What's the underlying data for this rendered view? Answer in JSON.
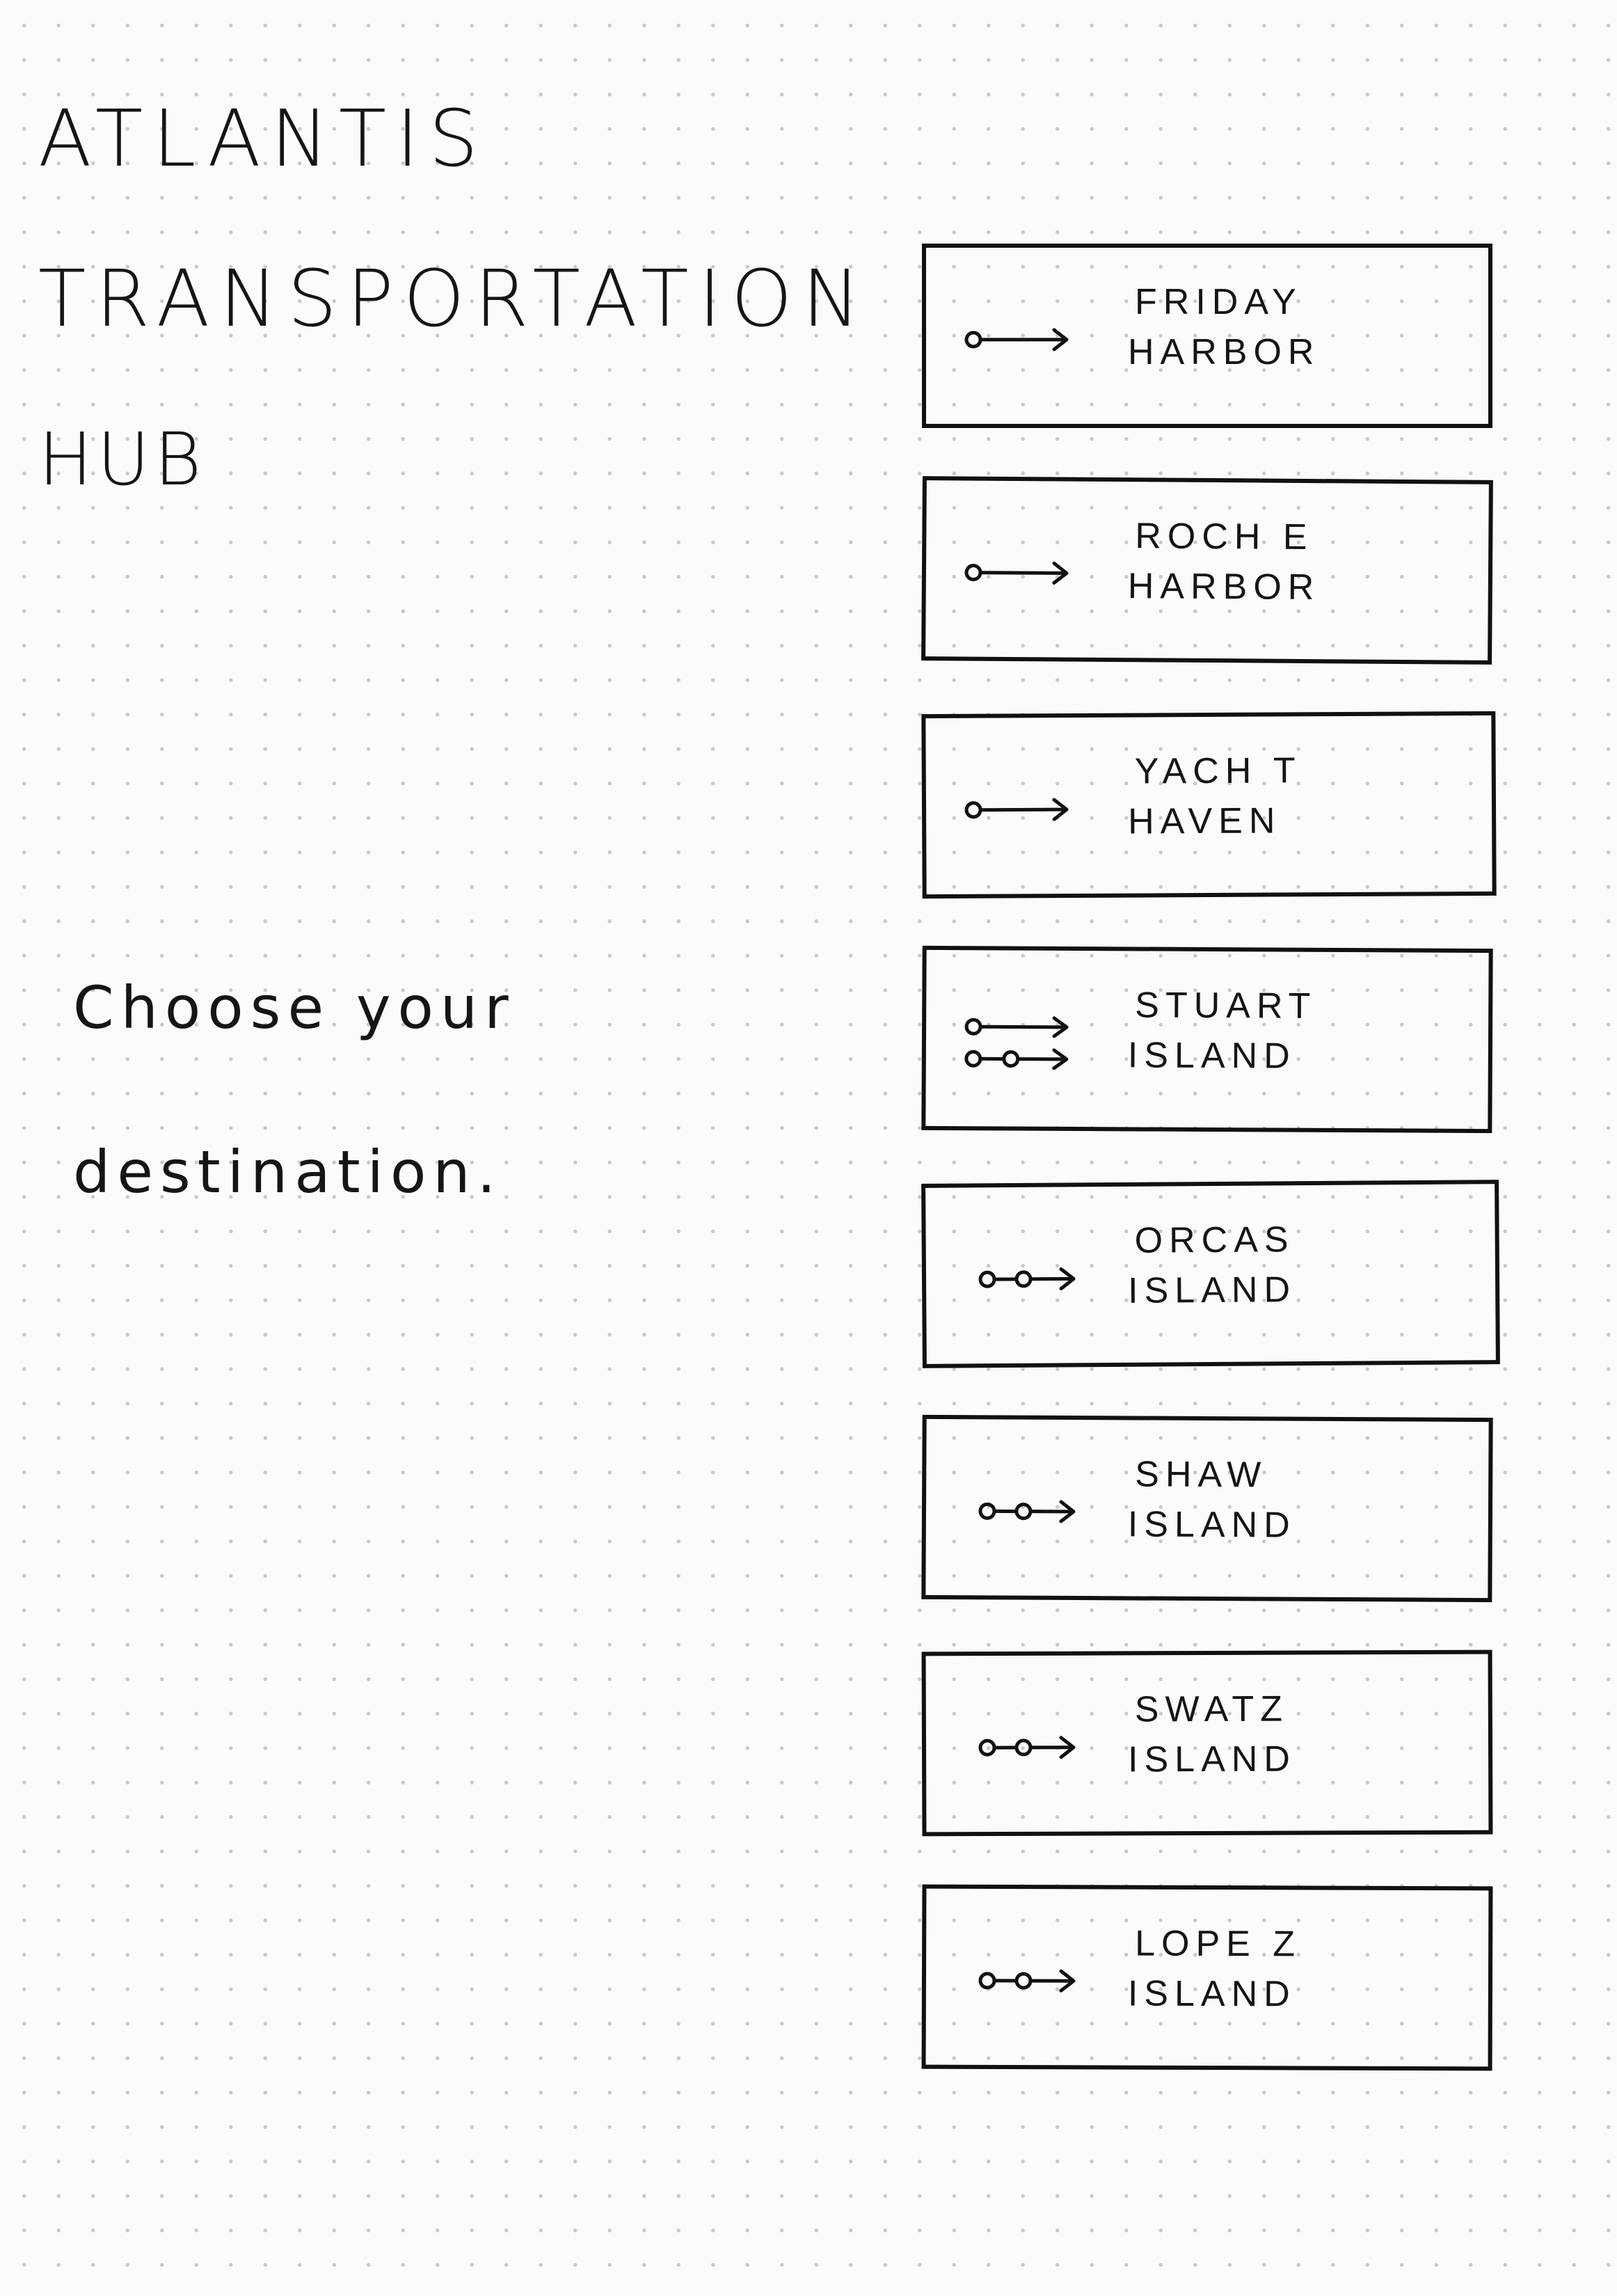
{
  "title": {
    "line1": "ATLANTIS",
    "line2": "TRANSPORTATION",
    "line3": "HUB"
  },
  "prompt": {
    "line1": "Choose your",
    "line2": "destination."
  },
  "destinations": [
    {
      "line1": "FRIDAY",
      "line2": "HARBOR",
      "route_icon": "direct-route-icon"
    },
    {
      "line1": "ROCH E",
      "line2": "HARBOR",
      "route_icon": "direct-route-icon"
    },
    {
      "line1": "YACH T",
      "line2": "HAVEN",
      "route_icon": "direct-route-icon"
    },
    {
      "line1": "STUART",
      "line2": "ISLAND",
      "route_icon": "direct-and-one-stop-route-icon"
    },
    {
      "line1": "ORCAS",
      "line2": "ISLAND",
      "route_icon": "one-stop-route-icon"
    },
    {
      "line1": "SHAW",
      "line2": "ISLAND",
      "route_icon": "one-stop-route-icon"
    },
    {
      "line1": "SWATZ",
      "line2": "ISLAND",
      "route_icon": "one-stop-route-icon"
    },
    {
      "line1": "LOPE Z",
      "line2": "ISLAND",
      "route_icon": "one-stop-route-icon"
    }
  ]
}
